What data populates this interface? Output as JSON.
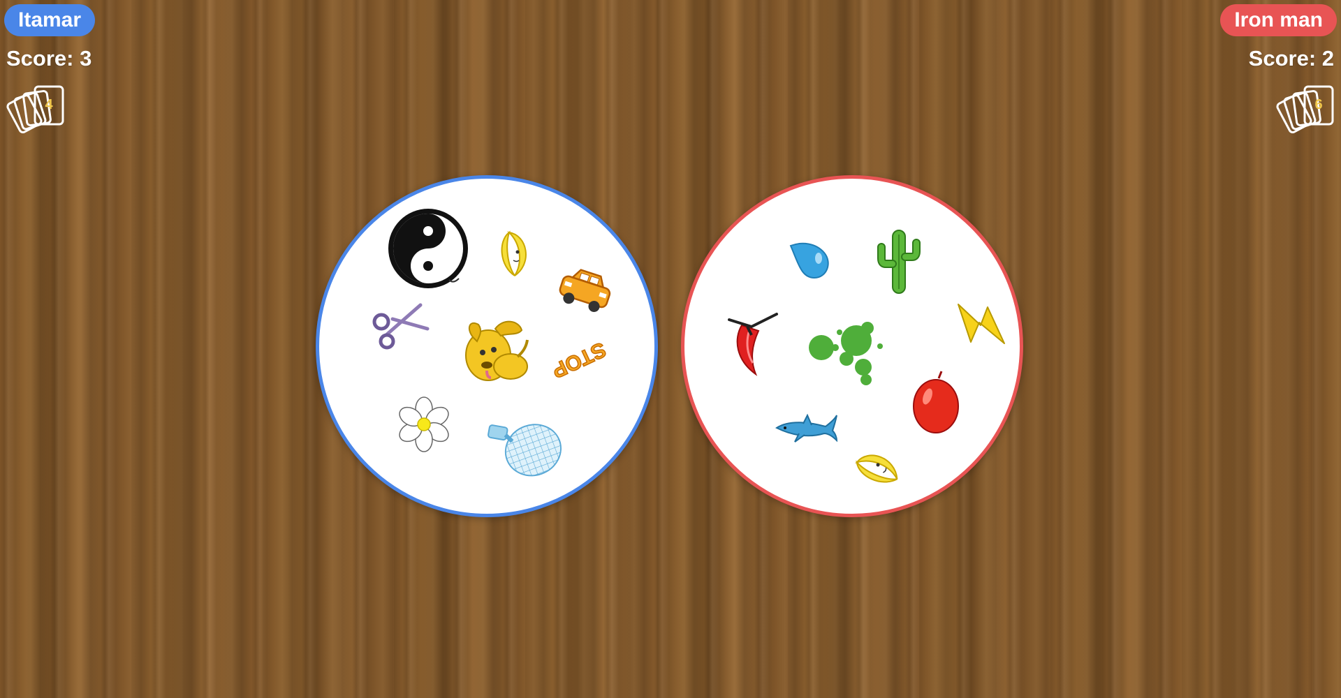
{
  "players": {
    "left": {
      "name": "Itamar",
      "score_text": "Score: 3",
      "cards_remaining": "4",
      "color": "#4a86e8"
    },
    "right": {
      "name": "Iron man",
      "score_text": "Score: 2",
      "cards_remaining": "6",
      "color": "#e85454"
    }
  },
  "cards": {
    "left": {
      "border_color": "#4a86e8",
      "symbols": [
        "yin-yang",
        "crescent-moon",
        "taxi-car",
        "scissors",
        "yellow-dog",
        "stop-sign",
        "daisy-flower",
        "glass-bottle"
      ]
    },
    "right": {
      "border_color": "#e85454",
      "symbols": [
        "water-drop",
        "cactus",
        "chili-pepper",
        "green-splash",
        "lightning-bolt",
        "red-balloon",
        "dolphin",
        "crescent-moon"
      ]
    }
  },
  "stop_label": "STOP",
  "background": "wood-floor"
}
